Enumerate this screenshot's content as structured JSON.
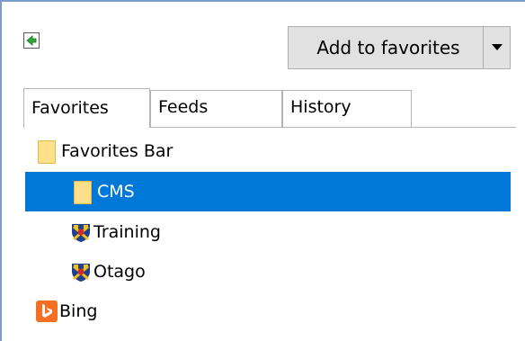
{
  "toolbar": {
    "pin_icon": "dock-arrow-icon",
    "add_button_label": "Add to favorites",
    "dropdown_icon": "triangle-down-icon"
  },
  "tabs": [
    {
      "label": "Favorites",
      "selected": true
    },
    {
      "label": "Feeds",
      "selected": false
    },
    {
      "label": "History",
      "selected": false
    }
  ],
  "tree": {
    "items": [
      {
        "label": "Favorites Bar",
        "icon": "folder-icon",
        "level": 0,
        "selected": false
      },
      {
        "label": "CMS",
        "icon": "folder-icon",
        "level": 1,
        "selected": true
      },
      {
        "label": "Training",
        "icon": "shield-crest-icon",
        "level": 1,
        "selected": false
      },
      {
        "label": "Otago",
        "icon": "shield-crest-icon",
        "level": 1,
        "selected": false
      },
      {
        "label": "Bing",
        "icon": "bing-logo-icon",
        "level": 0,
        "selected": false
      }
    ]
  },
  "colors": {
    "selection": "#0078d7",
    "folder": "#ffe08a",
    "button_face": "#e1e1e1",
    "bing_orange": "#f36f21"
  }
}
